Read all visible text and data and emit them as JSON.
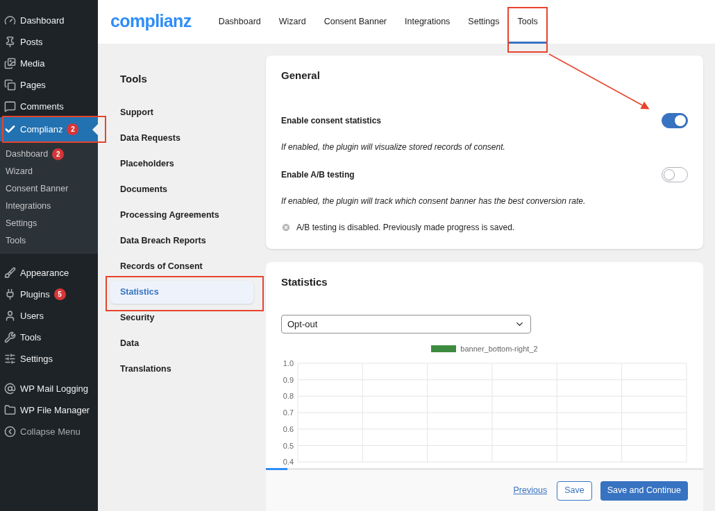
{
  "sidebar": {
    "items": [
      {
        "label": "Dashboard",
        "selected": false,
        "highlighted": false,
        "muted": false
      },
      {
        "label": "Posts",
        "selected": false,
        "highlighted": false,
        "muted": false
      },
      {
        "label": "Media",
        "selected": false,
        "highlighted": false,
        "muted": false
      },
      {
        "label": "Pages",
        "selected": false,
        "highlighted": false,
        "muted": false
      },
      {
        "label": "Comments",
        "selected": false,
        "highlighted": false,
        "muted": false
      },
      {
        "label": "Complianz",
        "badge": "2",
        "selected": true,
        "highlighted": true,
        "muted": false,
        "children": [
          {
            "label": "Dashboard",
            "badge": "2",
            "selected": false
          },
          {
            "label": "Wizard",
            "selected": false
          },
          {
            "label": "Consent Banner",
            "selected": false
          },
          {
            "label": "Integrations",
            "selected": false
          },
          {
            "label": "Settings",
            "selected": false
          },
          {
            "label": "Tools",
            "selected": false
          }
        ]
      },
      {
        "label": "Appearance",
        "selected": false,
        "highlighted": false,
        "muted": false
      },
      {
        "label": "Plugins",
        "badge": "5",
        "selected": false,
        "highlighted": false,
        "muted": false
      },
      {
        "label": "Users",
        "selected": false,
        "highlighted": false,
        "muted": false
      },
      {
        "label": "Tools",
        "selected": false,
        "highlighted": false,
        "muted": false
      },
      {
        "label": "Settings",
        "selected": false,
        "highlighted": false,
        "muted": false
      },
      {
        "label": "WP Mail Logging",
        "selected": false,
        "highlighted": false,
        "muted": false
      },
      {
        "label": "WP File Manager",
        "selected": false,
        "highlighted": false,
        "muted": false
      },
      {
        "label": "Collapse Menu",
        "selected": false,
        "highlighted": false,
        "muted": true
      }
    ]
  },
  "header": {
    "logo": "complianz",
    "tabs": [
      {
        "label": "Dashboard",
        "selected": false,
        "highlighted": false
      },
      {
        "label": "Wizard",
        "selected": false,
        "highlighted": false
      },
      {
        "label": "Consent Banner",
        "selected": false,
        "highlighted": false
      },
      {
        "label": "Integrations",
        "selected": false,
        "highlighted": false
      },
      {
        "label": "Settings",
        "selected": false,
        "highlighted": false
      },
      {
        "label": "Tools",
        "selected": true,
        "highlighted": true
      }
    ]
  },
  "callout_arrow": true,
  "tools_menu": {
    "title": "Tools",
    "items": [
      {
        "label": "Support",
        "selected": false,
        "highlighted": false
      },
      {
        "label": "Data Requests",
        "selected": false,
        "highlighted": false
      },
      {
        "label": "Placeholders",
        "selected": false,
        "highlighted": false
      },
      {
        "label": "Documents",
        "selected": false,
        "highlighted": false
      },
      {
        "label": "Processing Agreements",
        "selected": false,
        "highlighted": false
      },
      {
        "label": "Data Breach Reports",
        "selected": false,
        "highlighted": false
      },
      {
        "label": "Records of Consent",
        "selected": false,
        "highlighted": false
      },
      {
        "label": "Statistics",
        "selected": true,
        "highlighted": true
      },
      {
        "label": "Security",
        "selected": false,
        "highlighted": false
      },
      {
        "label": "Data",
        "selected": false,
        "highlighted": false
      },
      {
        "label": "Translations",
        "selected": false,
        "highlighted": false
      }
    ]
  },
  "general": {
    "title": "General",
    "settings": [
      {
        "label": "Enable consent statistics",
        "on": true,
        "help": "If enabled, the plugin will visualize stored records of consent."
      },
      {
        "label": "Enable A/B testing",
        "on": false,
        "help": "If enabled, the plugin will track which consent banner has the best conversion rate."
      }
    ],
    "notice": "A/B testing is disabled. Previously made progress is saved."
  },
  "statistics": {
    "title": "Statistics",
    "dropdown": "Opt-out",
    "chart_data": {
      "type": "line",
      "grid": true,
      "ylim": [
        0.4,
        1.0
      ],
      "series": [
        {
          "name": "banner_bottom-right_2",
          "color": "#3d8b40"
        }
      ],
      "yticks": [
        {
          "value": 0.4,
          "label": "0.4"
        },
        {
          "value": 0.5,
          "label": "0.5"
        },
        {
          "value": 0.6,
          "label": "0.6"
        },
        {
          "value": 0.7,
          "label": "0.7"
        },
        {
          "value": 0.8,
          "label": "0.8"
        },
        {
          "value": 0.9,
          "label": "0.9"
        },
        {
          "value": 1.0,
          "label": "1.0"
        }
      ]
    }
  },
  "footer": {
    "buttons": [
      {
        "kind": "link",
        "label": "Previous"
      },
      {
        "kind": "secondary",
        "label": "Save"
      },
      {
        "kind": "primary",
        "label": "Save and Continue"
      }
    ]
  }
}
